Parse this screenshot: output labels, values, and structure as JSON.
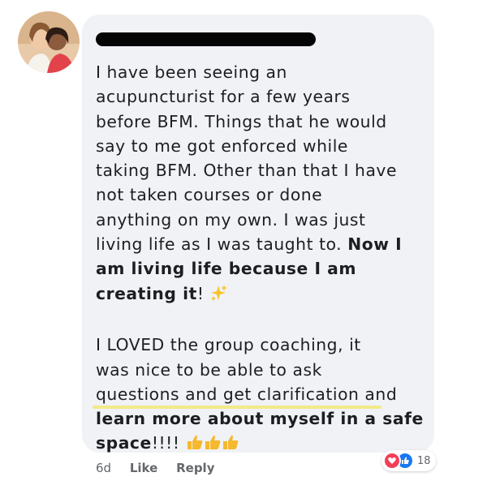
{
  "comment": {
    "lines": [
      "I have been seeing an",
      "acupuncturist for a few years",
      "before BFM. Things that he would",
      "say to me got enforced while",
      "taking BFM. Other than that I have",
      "not taken courses or done",
      "anything on my own. I was just",
      "living life as I was taught to. ",
      "Now I",
      "am living life because I am",
      "creating it",
      "! ",
      "I LOVED the group coaching, it",
      "was nice to be able to ask",
      "questions and get clarification",
      " and",
      "learn more about myself in a safe",
      "space",
      "!!!! "
    ]
  },
  "reactions": {
    "count": "18",
    "icons": [
      "heart-reaction-icon",
      "like-reaction-icon"
    ]
  },
  "actions": {
    "time": "6d",
    "like_label": "Like",
    "reply_label": "Reply"
  },
  "colors": {
    "bubble": "#f0f2f5",
    "text": "#1c1e21",
    "muted": "#65676b",
    "heart": "#f33e58",
    "like": "#1877f2",
    "highlight": "#f2e98a"
  }
}
